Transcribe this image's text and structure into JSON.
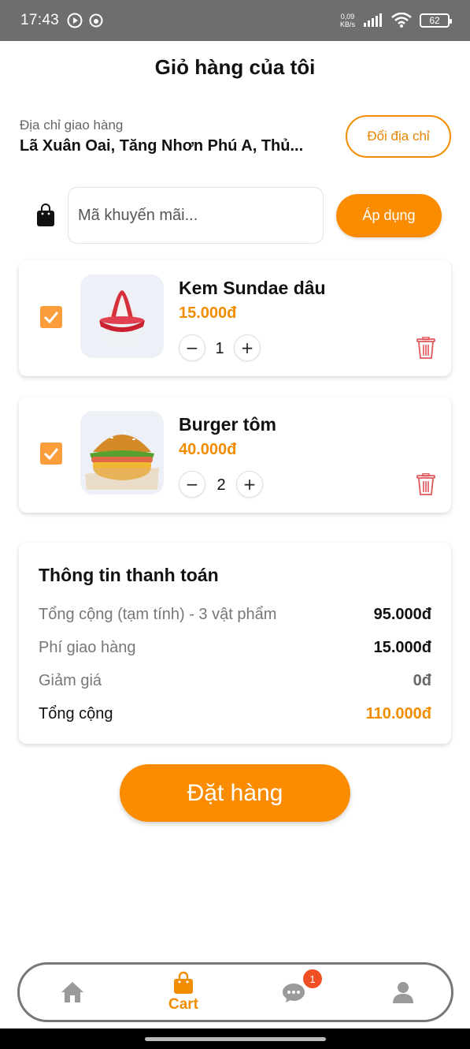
{
  "status_bar": {
    "time": "17:43",
    "net_speed_value": "0,09",
    "net_speed_unit": "KB/s",
    "battery": "62"
  },
  "header": {
    "title": "Giỏ hàng của tôi"
  },
  "address": {
    "label": "Địa chỉ giao hàng",
    "value": "Lã Xuân Oai, Tăng Nhơn Phú A, Thủ...",
    "change_label": "Đổi địa chỉ"
  },
  "promo": {
    "placeholder": "Mã khuyến mãi...",
    "apply_label": "Áp dụng"
  },
  "cart_items": [
    {
      "name": "Kem Sundae dâu",
      "price": "15.000đ",
      "quantity": "1",
      "checked": true,
      "decrease": "−",
      "increase": "+"
    },
    {
      "name": "Burger tôm",
      "price": "40.000đ",
      "quantity": "2",
      "checked": true,
      "decrease": "−",
      "increase": "+"
    }
  ],
  "summary": {
    "title": "Thông tin thanh toán",
    "rows": [
      {
        "label": "Tổng cộng (tạm tính) - 3 vật phẩm",
        "value": "95.000đ"
      },
      {
        "label": "Phí giao hàng",
        "value": "15.000đ"
      },
      {
        "label": "Giảm giá",
        "value": "0đ"
      },
      {
        "label": "Tổng cộng",
        "value": "110.000đ"
      }
    ]
  },
  "order_button": "Đặt hàng",
  "bottom_nav": {
    "cart_label": "Cart",
    "chat_badge": "1"
  },
  "colors": {
    "accent": "#fb8c00",
    "price": "#f28c00",
    "delete": "#e0565b",
    "badge": "#f04e23"
  }
}
